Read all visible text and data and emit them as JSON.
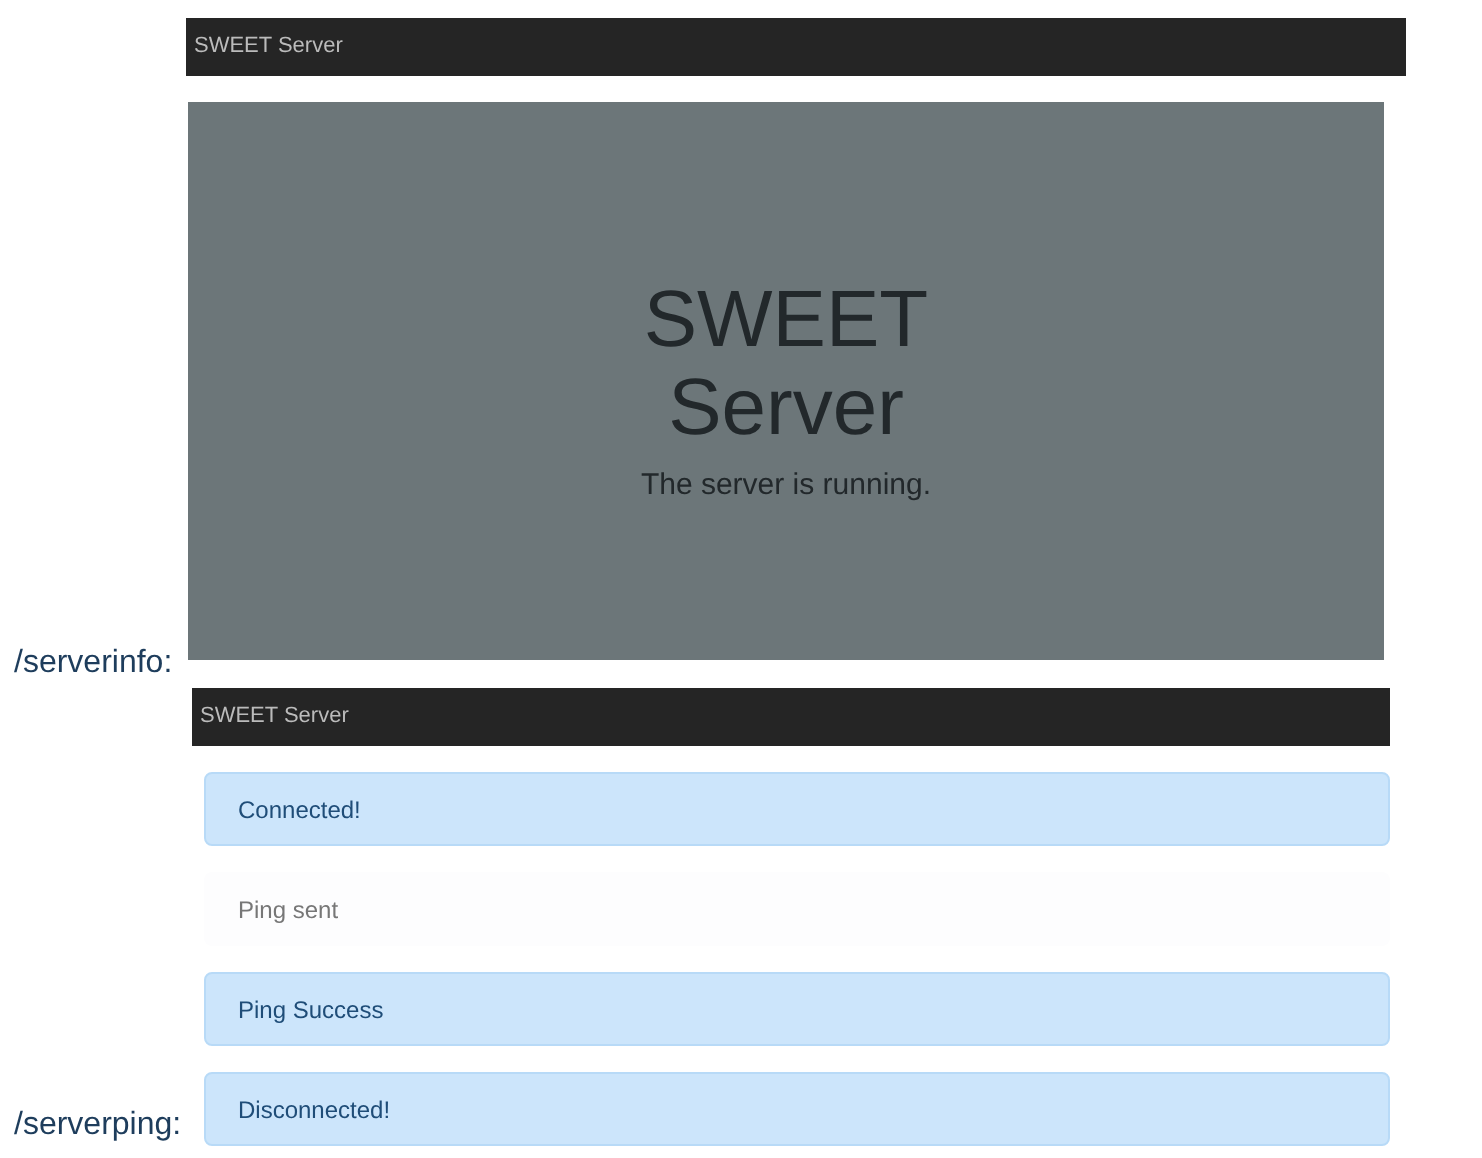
{
  "serverinfo": {
    "label": "/serverinfo:",
    "navbar_title": "SWEET Server",
    "heading_lines": [
      "SWEET",
      "Server"
    ],
    "subtitle": "The server is running."
  },
  "serverping": {
    "label": "/serverping:",
    "navbar_title": "SWEET Server",
    "alerts": [
      {
        "kind": "info",
        "text": "Connected!"
      },
      {
        "kind": "light",
        "text": "Ping sent"
      },
      {
        "kind": "info",
        "text": "Ping Success"
      },
      {
        "kind": "info",
        "text": "Disconnected!"
      }
    ]
  }
}
